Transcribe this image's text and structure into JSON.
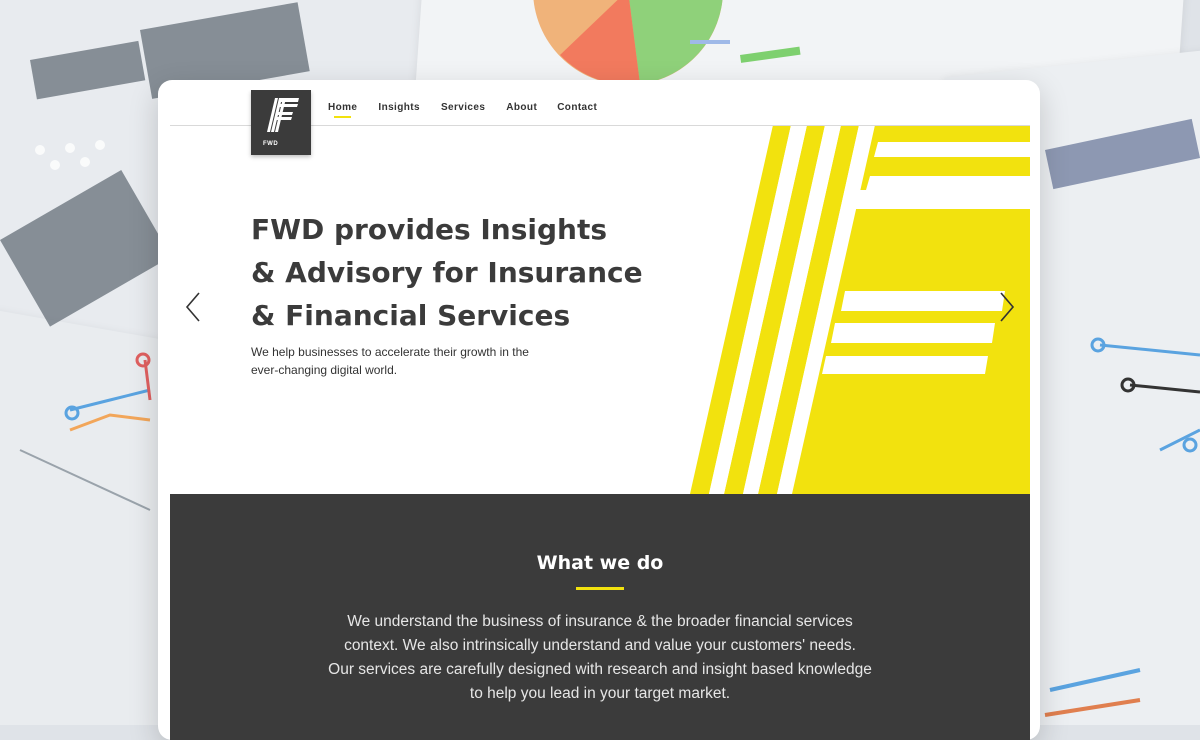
{
  "brand": {
    "logo_text": "FWD",
    "accent_color": "#f2e20e",
    "dark_color": "#3b3b3b"
  },
  "nav": {
    "items": [
      {
        "label": "Home",
        "active": true
      },
      {
        "label": "Insights",
        "active": false
      },
      {
        "label": "Services",
        "active": false
      },
      {
        "label": "About",
        "active": false
      },
      {
        "label": "Contact",
        "active": false
      }
    ]
  },
  "hero": {
    "title_lines": [
      "FWD provides Insights",
      "& Advisory for Insurance",
      "& Financial Services"
    ],
    "subtitle_lines": [
      "We help businesses to accelerate their growth in the",
      "ever-changing digital world."
    ],
    "prev_icon": "chevron-left-icon",
    "next_icon": "chevron-right-icon"
  },
  "what_we_do": {
    "title": "What we do",
    "text_lines": [
      "We understand the business of insurance & the broader financial services",
      "context. We also intrinsically understand and value your customers' needs.",
      "Our services are carefully designed with research and insight based knowledge",
      "to help you lead in your target market."
    ]
  }
}
